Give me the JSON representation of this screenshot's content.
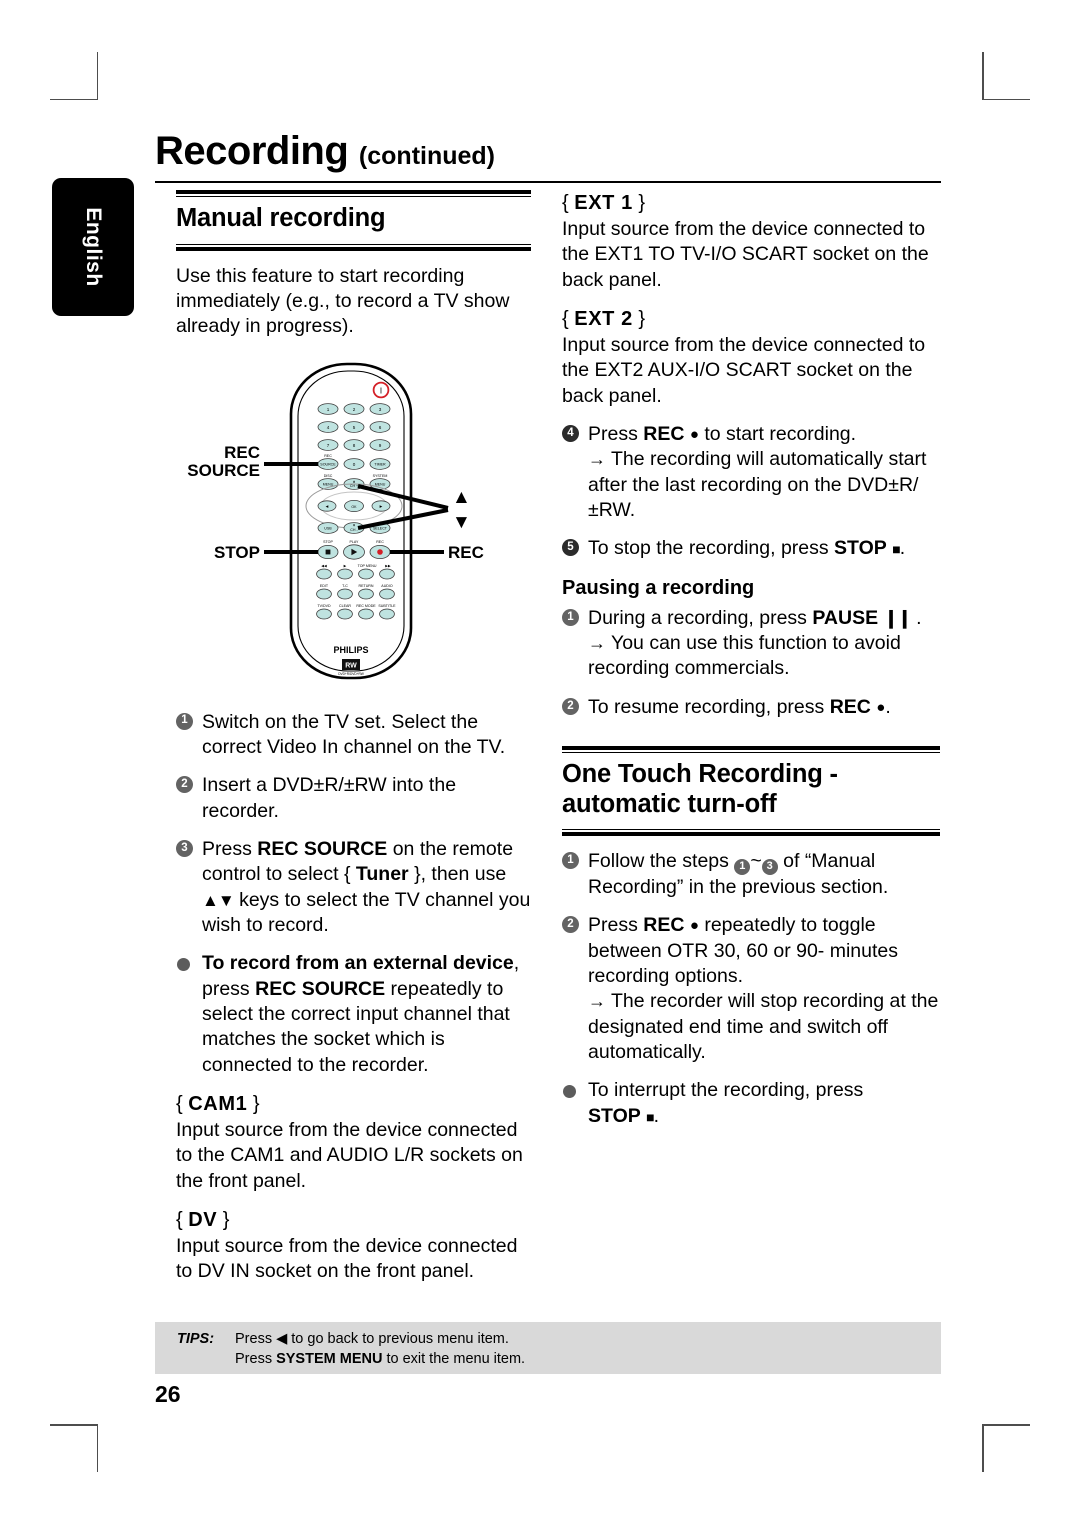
{
  "page": {
    "number": "26",
    "language_tab": "English",
    "title_main": "Recording",
    "title_suffix": "(continued)"
  },
  "left_column": {
    "section_title": "Manual recording",
    "intro": "Use this feature to start recording immediately (e.g., to record a TV show already in progress).",
    "remote": {
      "callouts": {
        "rec_source_line1": "REC",
        "rec_source_line2": "SOURCE",
        "stop": "STOP",
        "rec": "REC",
        "up_arrow": "▲",
        "down_arrow": "▼"
      },
      "brand": "PHILIPS",
      "logo_text": "RW",
      "logo_sub": "DVD+R/DVD+RW",
      "keys": {
        "power": "power-button",
        "digits": [
          "1",
          "2",
          "3",
          "4",
          "5",
          "6",
          "7",
          "8",
          "9",
          "0"
        ],
        "rec_source_label": "REC",
        "rec_source_key": "SOURCE",
        "timer_key": "TIMER",
        "disc_label": "DISC",
        "disc_menu_key": "MENU",
        "system_label": "SYSTEM",
        "system_menu_key": "MENU",
        "ch_up": "CH +",
        "ch_down": "CH -",
        "ok": "OK",
        "left": "◀",
        "right": "▶",
        "usb_key": "USB",
        "select_key": "SELECT",
        "stop_label": "STOP",
        "play_label": "PLAY",
        "rec_label": "REC",
        "row_labels_1": [
          "◀◀",
          "▶▶",
          "TOP MENU",
          "▶▶"
        ],
        "row_labels_2": [
          "EDIT",
          "T-C",
          "RETURN",
          "AUDIO"
        ],
        "row_labels_3": [
          "TV/DVD",
          "CLEAR",
          "RECORD MODE",
          "SUBTITLE"
        ]
      }
    },
    "steps": [
      {
        "n": "1",
        "text": "Switch on the TV set. Select the correct Video In channel on the TV."
      },
      {
        "n": "2",
        "text": "Insert a DVD±R/±RW into the recorder."
      }
    ],
    "step3": {
      "n": "3",
      "part1": "Press ",
      "bold1": "REC SOURCE",
      "part2": " on the remote control to select { ",
      "bold2": "Tuner",
      "part3": " }, then use ",
      "arrows": "▲▼",
      "part4": " keys to select the TV channel you wish to record."
    },
    "external_bullet": {
      "bold_lead": "To record from an external device",
      "part1": ", press ",
      "bold2": "REC SOURCE",
      "part2": " repeatedly to select the correct input channel that matches the socket which is connected to the recorder."
    },
    "sources": [
      {
        "label": "CAM1",
        "body": "Input source from the device connected to the CAM1 and AUDIO L/R sockets on the front panel."
      },
      {
        "label": "DV",
        "body": "Input source from the device connected to DV IN socket on the front panel."
      }
    ]
  },
  "right_column": {
    "sources": [
      {
        "label": "EXT 1",
        "body": "Input source from the device connected to the EXT1 TO TV-I/O SCART socket on the back panel."
      },
      {
        "label": "EXT 2",
        "body": "Input source from the device connected to the EXT2 AUX-I/O SCART socket on the back panel."
      }
    ],
    "step4": {
      "n": "4",
      "part1": "Press ",
      "bold1": "REC",
      "glyph": "●",
      "part2": " to start recording.",
      "arrow_text": "The recording will automatically start after the last recording on the DVD±R/±RW."
    },
    "step5": {
      "n": "5",
      "part1": "To stop the recording, press ",
      "bold1": "STOP",
      "glyph": "■",
      "part2": "."
    },
    "pausing": {
      "heading": "Pausing a recording",
      "step1": {
        "n": "1",
        "part1": "During a recording, press ",
        "bold1": "PAUSE",
        "glyph": "❙❙",
        "part2": " .",
        "arrow_text": "You can use this function to avoid recording commercials."
      },
      "step2": {
        "n": "2",
        "part1": "To resume recording, press ",
        "bold1": "REC",
        "glyph": "●",
        "part2": "."
      }
    },
    "otr": {
      "section_title_line1": "One Touch Recording -",
      "section_title_line2": "automatic turn-off",
      "step1": {
        "n": "1",
        "part1": "Follow the steps ",
        "ref1": "1",
        "mid": "~",
        "ref2": "3",
        "part2": " of “Manual Recording” in the previous section."
      },
      "step2": {
        "n": "2",
        "part1": "Press ",
        "bold1": "REC",
        "glyph": "●",
        "part2": " repeatedly to toggle between OTR 30, 60 or 90- minutes recording options.",
        "arrow_text": "The recorder  will stop recording at the designated end time and switch off automatically."
      },
      "interrupt": {
        "part1": "To interrupt the recording, press ",
        "bold1": "STOP",
        "glyph": "■",
        "part2": "."
      }
    }
  },
  "tips": {
    "label": "TIPS:",
    "line1_pre": "Press ",
    "line1_glyph": "◀",
    "line1_post": " to go back to previous menu item.",
    "line2_pre": "Press ",
    "line2_bold": "SYSTEM MENU",
    "line2_post": " to exit the menu item."
  },
  "colors": {
    "tips_bg": "#d9d9d9",
    "step_badge": "#636363",
    "remote_button": "#bfe3e0",
    "remote_power": "#d42027"
  }
}
